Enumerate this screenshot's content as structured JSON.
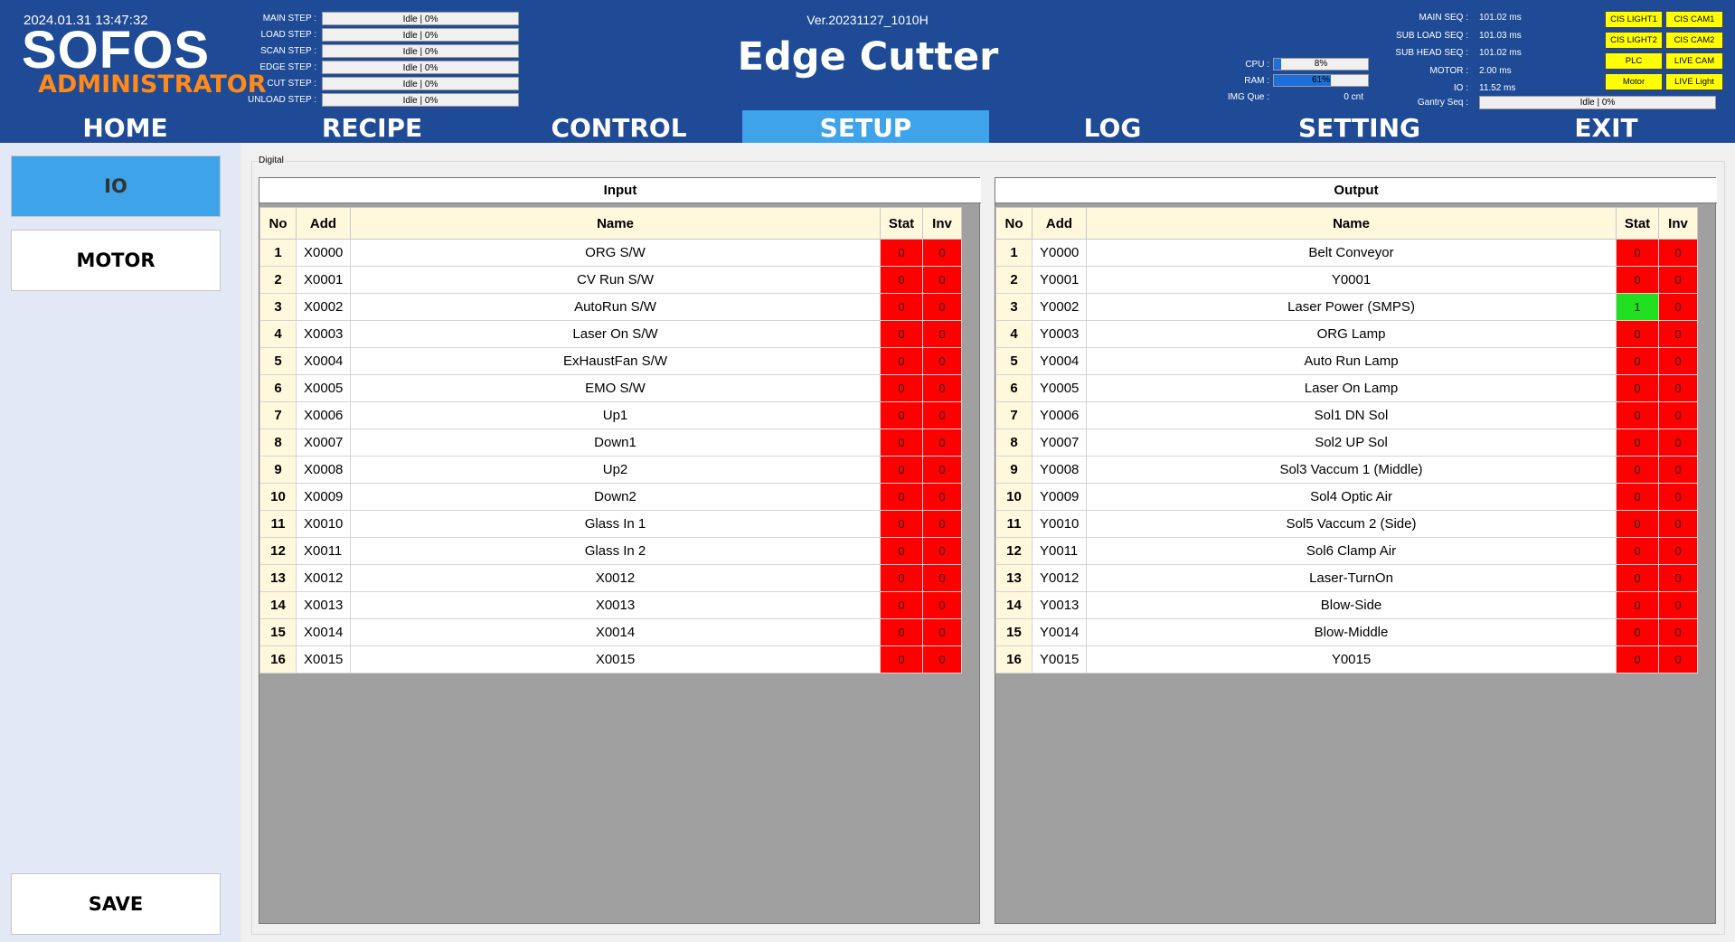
{
  "header": {
    "datetime": "2024.01.31 13:47:32",
    "logo": "SOFOS",
    "user_level": "ADMINISTRATOR",
    "version": "Ver.20231127_1010H",
    "title": "Edge Cutter",
    "steps": [
      {
        "label": "MAIN STEP :",
        "value": "Idle | 0%"
      },
      {
        "label": "LOAD STEP :",
        "value": "Idle | 0%"
      },
      {
        "label": "SCAN STEP :",
        "value": "Idle | 0%"
      },
      {
        "label": "EDGE STEP :",
        "value": "Idle | 0%"
      },
      {
        "label": "CUT STEP :",
        "value": "Idle | 0%"
      },
      {
        "label": "UNLOAD STEP :",
        "value": "Idle | 0%"
      }
    ],
    "resources": {
      "cpu": {
        "label": "CPU :",
        "text": "8%",
        "percent": 8
      },
      "ram": {
        "label": "RAM :",
        "text": "61%",
        "percent": 61
      },
      "img_que": {
        "label": "IMG Que :",
        "value": "0 cnt"
      }
    },
    "seqs": [
      {
        "label": "MAIN SEQ :",
        "value": "101.02 ms"
      },
      {
        "label": "SUB LOAD SEQ :",
        "value": "101.03 ms"
      },
      {
        "label": "SUB HEAD SEQ :",
        "value": "101.02 ms"
      },
      {
        "label": "MOTOR :",
        "value": "2.00 ms"
      },
      {
        "label": "IO :",
        "value": "11.52 ms"
      }
    ],
    "gantry": {
      "label": "Gantry Seq :",
      "value": "Idle | 0%"
    },
    "status_buttons": [
      "CIS LIGHT1",
      "CIS CAM1",
      "CIS LIGHT2",
      "CIS CAM2",
      "PLC",
      "LIVE CAM",
      "Motor",
      "LIVE Light"
    ],
    "status_color": "#ffff00"
  },
  "nav": {
    "tabs": [
      "HOME",
      "RECIPE",
      "CONTROL",
      "SETUP",
      "LOG",
      "SETTING",
      "EXIT"
    ],
    "active": "SETUP",
    "active_color": "#3ea3e8",
    "bar_color": "#1e4a96"
  },
  "sidebar": {
    "io": "IO",
    "motor": "MOTOR",
    "save": "SAVE"
  },
  "main": {
    "group_label": "Digital",
    "columns": {
      "no": "No",
      "add": "Add",
      "name": "Name",
      "stat": "Stat",
      "inv": "Inv"
    },
    "input": {
      "title": "Input",
      "rows": [
        {
          "no": "1",
          "add": "X0000",
          "name": "ORG S/W",
          "stat": "0",
          "inv": "0"
        },
        {
          "no": "2",
          "add": "X0001",
          "name": "CV Run S/W",
          "stat": "0",
          "inv": "0"
        },
        {
          "no": "3",
          "add": "X0002",
          "name": "AutoRun S/W",
          "stat": "0",
          "inv": "0"
        },
        {
          "no": "4",
          "add": "X0003",
          "name": "Laser On S/W",
          "stat": "0",
          "inv": "0"
        },
        {
          "no": "5",
          "add": "X0004",
          "name": "ExHaustFan S/W",
          "stat": "0",
          "inv": "0"
        },
        {
          "no": "6",
          "add": "X0005",
          "name": "EMO S/W",
          "stat": "0",
          "inv": "0"
        },
        {
          "no": "7",
          "add": "X0006",
          "name": "Up1",
          "stat": "0",
          "inv": "0"
        },
        {
          "no": "8",
          "add": "X0007",
          "name": "Down1",
          "stat": "0",
          "inv": "0"
        },
        {
          "no": "9",
          "add": "X0008",
          "name": "Up2",
          "stat": "0",
          "inv": "0"
        },
        {
          "no": "10",
          "add": "X0009",
          "name": "Down2",
          "stat": "0",
          "inv": "0"
        },
        {
          "no": "11",
          "add": "X0010",
          "name": "Glass In 1",
          "stat": "0",
          "inv": "0"
        },
        {
          "no": "12",
          "add": "X0011",
          "name": "Glass In 2",
          "stat": "0",
          "inv": "0"
        },
        {
          "no": "13",
          "add": "X0012",
          "name": "X0012",
          "stat": "0",
          "inv": "0"
        },
        {
          "no": "14",
          "add": "X0013",
          "name": "X0013",
          "stat": "0",
          "inv": "0"
        },
        {
          "no": "15",
          "add": "X0014",
          "name": "X0014",
          "stat": "0",
          "inv": "0"
        },
        {
          "no": "16",
          "add": "X0015",
          "name": "X0015",
          "stat": "0",
          "inv": "0"
        }
      ]
    },
    "output": {
      "title": "Output",
      "rows": [
        {
          "no": "1",
          "add": "Y0000",
          "name": "Belt Conveyor",
          "stat": "0",
          "inv": "0"
        },
        {
          "no": "2",
          "add": "Y0001",
          "name": "Y0001",
          "stat": "0",
          "inv": "0"
        },
        {
          "no": "3",
          "add": "Y0002",
          "name": "Laser Power (SMPS)",
          "stat": "1",
          "inv": "0"
        },
        {
          "no": "4",
          "add": "Y0003",
          "name": "ORG Lamp",
          "stat": "0",
          "inv": "0"
        },
        {
          "no": "5",
          "add": "Y0004",
          "name": "Auto Run Lamp",
          "stat": "0",
          "inv": "0"
        },
        {
          "no": "6",
          "add": "Y0005",
          "name": "Laser On Lamp",
          "stat": "0",
          "inv": "0"
        },
        {
          "no": "7",
          "add": "Y0006",
          "name": "Sol1 DN Sol",
          "stat": "0",
          "inv": "0"
        },
        {
          "no": "8",
          "add": "Y0007",
          "name": "Sol2 UP Sol",
          "stat": "0",
          "inv": "0"
        },
        {
          "no": "9",
          "add": "Y0008",
          "name": "Sol3 Vaccum 1 (Middle)",
          "stat": "0",
          "inv": "0"
        },
        {
          "no": "10",
          "add": "Y0009",
          "name": "Sol4 Optic Air",
          "stat": "0",
          "inv": "0"
        },
        {
          "no": "11",
          "add": "Y0010",
          "name": "Sol5 Vaccum 2 (Side)",
          "stat": "0",
          "inv": "0"
        },
        {
          "no": "12",
          "add": "Y0011",
          "name": "Sol6 Clamp Air",
          "stat": "0",
          "inv": "0"
        },
        {
          "no": "13",
          "add": "Y0012",
          "name": "Laser-TurnOn",
          "stat": "0",
          "inv": "0"
        },
        {
          "no": "14",
          "add": "Y0013",
          "name": "Blow-Side",
          "stat": "0",
          "inv": "0"
        },
        {
          "no": "15",
          "add": "Y0014",
          "name": "Blow-Middle",
          "stat": "0",
          "inv": "0"
        },
        {
          "no": "16",
          "add": "Y0015",
          "name": "Y0015",
          "stat": "0",
          "inv": "0"
        }
      ]
    },
    "colors": {
      "off": "#ff0000",
      "on": "#20e020",
      "header_bg": "#fff8dc",
      "panel_bg": "#a0a0a0"
    }
  }
}
